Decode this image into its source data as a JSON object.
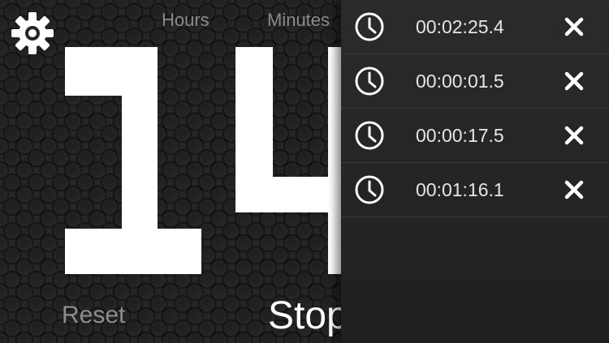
{
  "header": {
    "hours_label": "Hours",
    "minutes_label": "Minutes",
    "settings_icon": "gear-icon"
  },
  "display": {
    "hours": "1",
    "minutes_partial": "4"
  },
  "controls": {
    "reset_label": "Reset",
    "stop_label": "Stop"
  },
  "laps": [
    {
      "time": "00:02:25.4",
      "icon": "clock-icon",
      "delete_icon": "close-icon"
    },
    {
      "time": "00:00:01.5",
      "icon": "clock-icon",
      "delete_icon": "close-icon"
    },
    {
      "time": "00:00:17.5",
      "icon": "clock-icon",
      "delete_icon": "close-icon"
    },
    {
      "time": "00:01:16.1",
      "icon": "clock-icon",
      "delete_icon": "close-icon"
    }
  ],
  "colors": {
    "background": "#262626",
    "digit": "#ffffff",
    "label": "#8a8a8a",
    "panel": "#262626"
  }
}
